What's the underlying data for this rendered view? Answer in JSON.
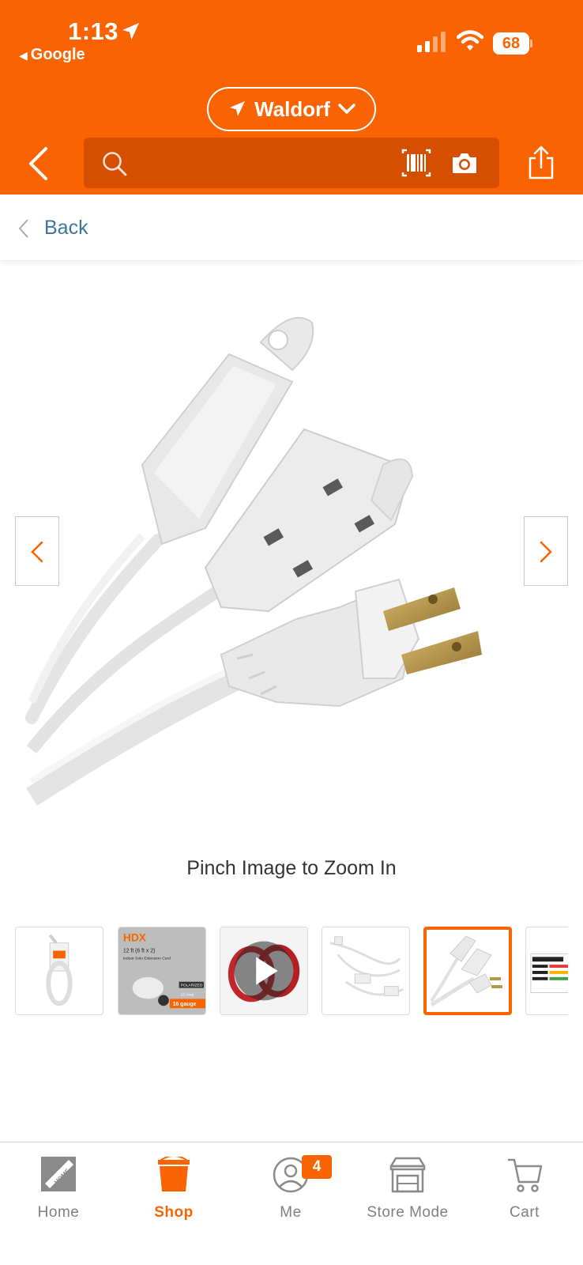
{
  "status_bar": {
    "time": "1:13",
    "back_app": "Google",
    "battery": "68"
  },
  "header": {
    "store_name": "Waldorf",
    "search_placeholder": ""
  },
  "back_row": {
    "label": "Back"
  },
  "gallery": {
    "zoom_hint": "Pinch Image to Zoom In",
    "selected_thumbnail": 5,
    "thumbnail_count_visible": 6
  },
  "colors": {
    "brand": "#f96302",
    "search_bar": "#d64f00",
    "link": "#3e7697"
  },
  "tabbar": {
    "tabs": [
      {
        "label": "Home",
        "icon": "home-depot-logo-icon",
        "active": false
      },
      {
        "label": "Shop",
        "icon": "shop-bucket-icon",
        "active": true
      },
      {
        "label": "Me",
        "icon": "user-icon",
        "active": false,
        "badge": "4"
      },
      {
        "label": "Store Mode",
        "icon": "store-icon",
        "active": false
      },
      {
        "label": "Cart",
        "icon": "cart-icon",
        "active": false
      }
    ]
  },
  "thumbnail_text": {
    "brand": "HDX",
    "title_line": "12 ft (6 ft x 2)",
    "subtitle_line": "Indoor Solo Extension Cord",
    "polarized": "POLARIZED",
    "amp": "13 Amp",
    "gauge": "16 gauge"
  }
}
